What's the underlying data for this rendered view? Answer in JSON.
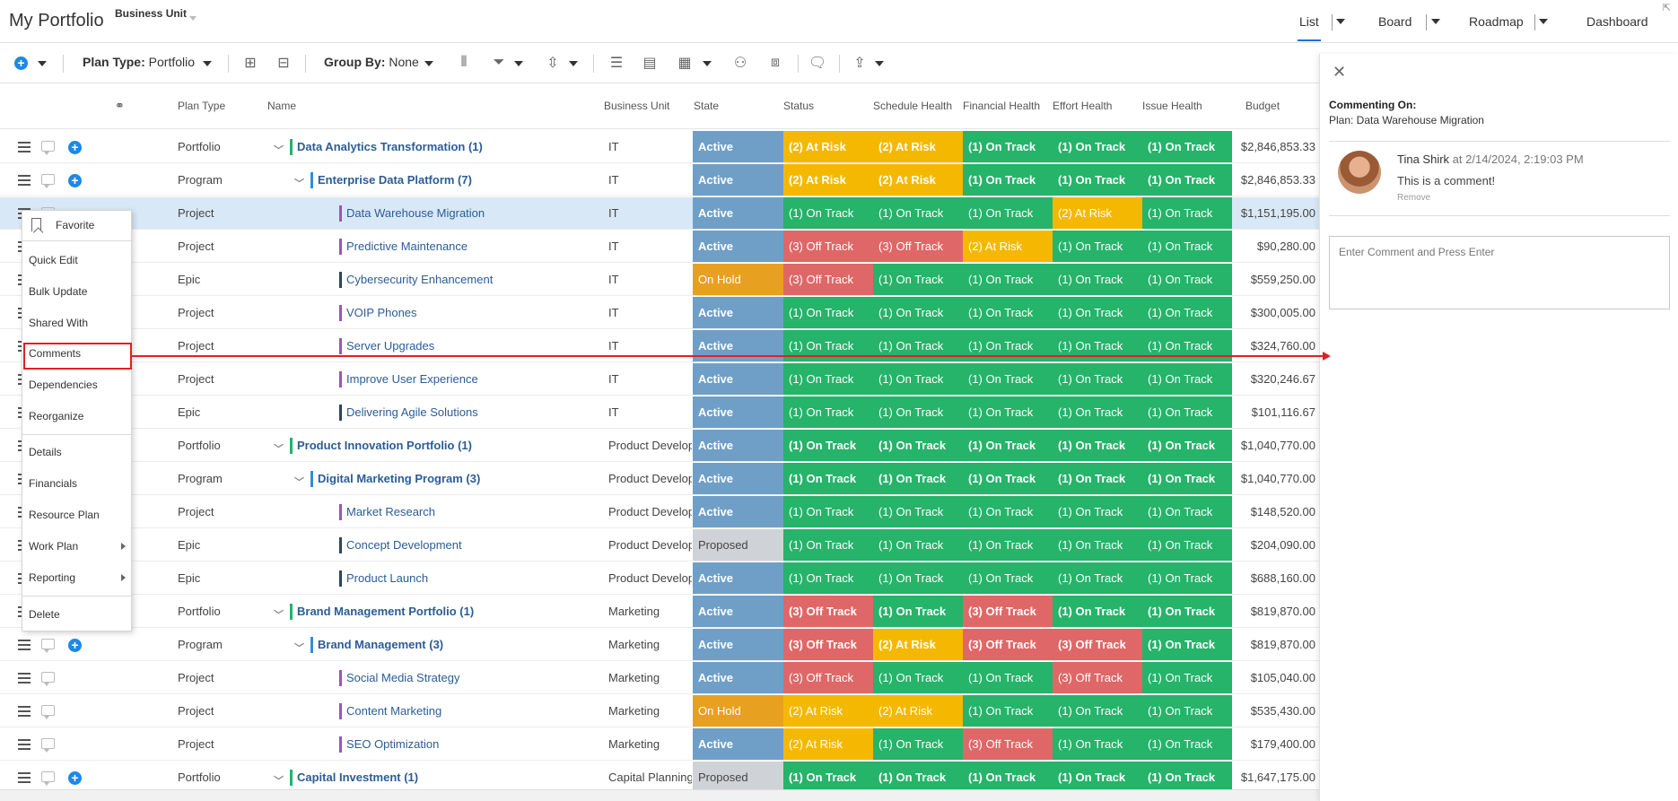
{
  "header": {
    "title": "My Portfolio",
    "business_unit_label": "Business Unit",
    "views": [
      "List",
      "Board",
      "Roadmap",
      "Dashboard"
    ],
    "active_view": "List"
  },
  "toolbar": {
    "plan_type_label": "Plan Type:",
    "plan_type_value": "Portfolio",
    "group_by_label": "Group By:",
    "group_by_value": "None"
  },
  "columns": {
    "plan_type": "Plan Type",
    "name": "Name",
    "business_unit": "Business Unit",
    "state": "State",
    "status": "Status",
    "schedule_health": "Schedule Health",
    "financial_health": "Financial Health",
    "effort_health": "Effort Health",
    "issue_health": "Issue Health",
    "budget": "Budget"
  },
  "colors": {
    "active": "#6f9fc7",
    "on_hold": "#e8a020",
    "proposed": "#cfd3d8",
    "on_track": "#26b36a",
    "at_risk": "#f5b800",
    "off_track": "#e06767",
    "portfolio_bar": "#21b36c",
    "program_bar": "#2e8fd8",
    "project_bar": "#a44fc0",
    "epic_bar": "#2f4462",
    "accent": "#1e6fd9"
  },
  "rows": [
    {
      "type": "Portfolio",
      "name": "Data Analytics Transformation (1)",
      "level": 0,
      "bu": "IT",
      "state": "Active",
      "status": "(2) At Risk",
      "schedule": "(2) At Risk",
      "financial": "(1) On Track",
      "effort": "(1) On Track",
      "issue": "(1) On Track",
      "budget": "$2,846,853.33",
      "add": true
    },
    {
      "type": "Program",
      "name": "Enterprise Data Platform (7)",
      "level": 1,
      "bu": "IT",
      "state": "Active",
      "status": "(2) At Risk",
      "schedule": "(2) At Risk",
      "financial": "(1) On Track",
      "effort": "(1) On Track",
      "issue": "(1) On Track",
      "budget": "$2,846,853.33",
      "add": true
    },
    {
      "type": "Project",
      "name": "Data Warehouse Migration",
      "level": 2,
      "bu": "IT",
      "state": "Active",
      "status": "(1) On Track",
      "schedule": "(1) On Track",
      "financial": "(1) On Track",
      "effort": "(2) At Risk",
      "issue": "(1) On Track",
      "budget": "$1,151,195.00",
      "selected": true
    },
    {
      "type": "Project",
      "name": "Predictive Maintenance",
      "level": 2,
      "bu": "IT",
      "state": "Active",
      "status": "(3) Off Track",
      "schedule": "(3) Off Track",
      "financial": "(2) At Risk",
      "effort": "(1) On Track",
      "issue": "(1) On Track",
      "budget": "$90,280.00"
    },
    {
      "type": "Epic",
      "name": "Cybersecurity Enhancement",
      "level": 2,
      "bu": "IT",
      "state": "On Hold",
      "status": "(3) Off Track",
      "schedule": "(1) On Track",
      "financial": "(1) On Track",
      "effort": "(1) On Track",
      "issue": "(1) On Track",
      "budget": "$559,250.00"
    },
    {
      "type": "Project",
      "name": "VOIP Phones",
      "level": 2,
      "bu": "IT",
      "state": "Active",
      "status": "(1) On Track",
      "schedule": "(1) On Track",
      "financial": "(1) On Track",
      "effort": "(1) On Track",
      "issue": "(1) On Track",
      "budget": "$300,005.00"
    },
    {
      "type": "Project",
      "name": "Server Upgrades",
      "level": 2,
      "bu": "IT",
      "state": "Active",
      "status": "(1) On Track",
      "schedule": "(1) On Track",
      "financial": "(1) On Track",
      "effort": "(1) On Track",
      "issue": "(1) On Track",
      "budget": "$324,760.00"
    },
    {
      "type": "Project",
      "name": "Improve User Experience",
      "level": 2,
      "bu": "IT",
      "state": "Active",
      "status": "(1) On Track",
      "schedule": "(1) On Track",
      "financial": "(1) On Track",
      "effort": "(1) On Track",
      "issue": "(1) On Track",
      "budget": "$320,246.67"
    },
    {
      "type": "Epic",
      "name": "Delivering Agile Solutions",
      "level": 2,
      "bu": "IT",
      "state": "Active",
      "status": "(1) On Track",
      "schedule": "(1) On Track",
      "financial": "(1) On Track",
      "effort": "(1) On Track",
      "issue": "(1) On Track",
      "budget": "$101,116.67"
    },
    {
      "type": "Portfolio",
      "name": "Product Innovation Portfolio (1)",
      "level": 0,
      "bu": "Product Develop",
      "state": "Active",
      "status": "(1) On Track",
      "schedule": "(1) On Track",
      "financial": "(1) On Track",
      "effort": "(1) On Track",
      "issue": "(1) On Track",
      "budget": "$1,040,770.00"
    },
    {
      "type": "Program",
      "name": "Digital Marketing Program (3)",
      "level": 1,
      "bu": "Product Develop",
      "state": "Active",
      "status": "(1) On Track",
      "schedule": "(1) On Track",
      "financial": "(1) On Track",
      "effort": "(1) On Track",
      "issue": "(1) On Track",
      "budget": "$1,040,770.00"
    },
    {
      "type": "Project",
      "name": "Market Research",
      "level": 2,
      "bu": "Product Develop",
      "state": "Active",
      "status": "(1) On Track",
      "schedule": "(1) On Track",
      "financial": "(1) On Track",
      "effort": "(1) On Track",
      "issue": "(1) On Track",
      "budget": "$148,520.00"
    },
    {
      "type": "Epic",
      "name": "Concept Development",
      "level": 2,
      "bu": "Product Develop",
      "state": "Proposed",
      "status": "(1) On Track",
      "schedule": "(1) On Track",
      "financial": "(1) On Track",
      "effort": "(1) On Track",
      "issue": "(1) On Track",
      "budget": "$204,090.00"
    },
    {
      "type": "Epic",
      "name": "Product Launch",
      "level": 2,
      "bu": "Product Develop",
      "state": "Active",
      "status": "(1) On Track",
      "schedule": "(1) On Track",
      "financial": "(1) On Track",
      "effort": "(1) On Track",
      "issue": "(1) On Track",
      "budget": "$688,160.00"
    },
    {
      "type": "Portfolio",
      "name": "Brand Management Portfolio (1)",
      "level": 0,
      "bu": "Marketing",
      "state": "Active",
      "status": "(3) Off Track",
      "schedule": "(1) On Track",
      "financial": "(3) Off Track",
      "effort": "(1) On Track",
      "issue": "(1) On Track",
      "budget": "$819,870.00"
    },
    {
      "type": "Program",
      "name": "Brand Management (3)",
      "level": 1,
      "bu": "Marketing",
      "state": "Active",
      "status": "(3) Off Track",
      "schedule": "(2) At Risk",
      "financial": "(3) Off Track",
      "effort": "(3) Off Track",
      "issue": "(1) On Track",
      "budget": "$819,870.00",
      "add": true
    },
    {
      "type": "Project",
      "name": "Social Media Strategy",
      "level": 2,
      "bu": "Marketing",
      "state": "Active",
      "status": "(3) Off Track",
      "schedule": "(1) On Track",
      "financial": "(1) On Track",
      "effort": "(3) Off Track",
      "issue": "(1) On Track",
      "budget": "$105,040.00"
    },
    {
      "type": "Project",
      "name": "Content Marketing",
      "level": 2,
      "bu": "Marketing",
      "state": "On Hold",
      "status": "(2) At Risk",
      "schedule": "(2) At Risk",
      "financial": "(1) On Track",
      "effort": "(1) On Track",
      "issue": "(1) On Track",
      "budget": "$535,430.00"
    },
    {
      "type": "Project",
      "name": "SEO Optimization",
      "level": 2,
      "bu": "Marketing",
      "state": "Active",
      "status": "(2) At Risk",
      "schedule": "(1) On Track",
      "financial": "(3) Off Track",
      "effort": "(1) On Track",
      "issue": "(1) On Track",
      "budget": "$179,400.00"
    },
    {
      "type": "Portfolio",
      "name": "Capital Investment (1)",
      "level": 0,
      "bu": "Capital Planning",
      "state": "Proposed",
      "status": "(1) On Track",
      "schedule": "(1) On Track",
      "financial": "(1) On Track",
      "effort": "(1) On Track",
      "issue": "(1) On Track",
      "budget": "$1,647,175.00",
      "add": true
    }
  ],
  "context_menu": {
    "groups": [
      [
        "Favorite"
      ],
      [
        "Quick Edit",
        "Bulk Update",
        "Shared With",
        "Comments",
        "Dependencies",
        "Reorganize"
      ],
      [
        "Details",
        "Financials",
        "Resource Plan",
        "Work Plan",
        "Reporting"
      ],
      [
        "Delete"
      ]
    ],
    "highlighted": "Comments"
  },
  "comment_panel": {
    "heading": "Commenting On:",
    "plan": "Plan: Data Warehouse Migration",
    "author": "Tina Shirk",
    "timestamp": "at 2/14/2024, 2:19:03 PM",
    "comment": "This is a comment!",
    "remove_label": "Remove",
    "input_placeholder": "Enter Comment and Press Enter"
  }
}
